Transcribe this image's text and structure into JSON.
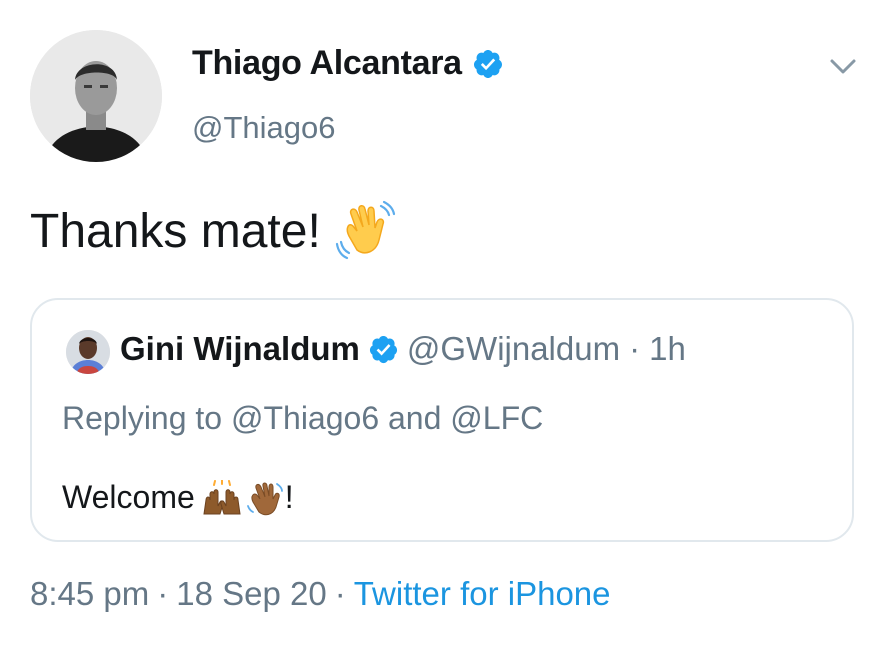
{
  "tweet": {
    "author_name": "Thiago Alcantara",
    "author_handle": "@Thiago6",
    "text": "Thanks mate!",
    "time": "8:45 pm",
    "date": "18 Sep 20",
    "source": "Twitter for iPhone",
    "separator": "·"
  },
  "quote": {
    "author_name": "Gini Wijnaldum",
    "author_handle": "@GWijnaldum",
    "time": "1h",
    "separator": "·",
    "reply_prefix": "Replying to",
    "reply_user_1": "@Thiago6",
    "reply_and": "and",
    "reply_user_2": "@LFC",
    "text": "Welcome",
    "text_suffix": "!"
  },
  "icons": {
    "verified": "verified-badge-icon",
    "menu": "chevron-down-icon",
    "wave": "waving-hand-emoji",
    "raised_hands": "raised-hands-emoji",
    "clap": "waving-hand-dark-emoji"
  },
  "colors": {
    "brand_blue": "#1da1f2",
    "link_blue": "#1b95e0",
    "muted_text": "#657786",
    "primary_text": "#14171a",
    "border": "#e1e8ed"
  }
}
